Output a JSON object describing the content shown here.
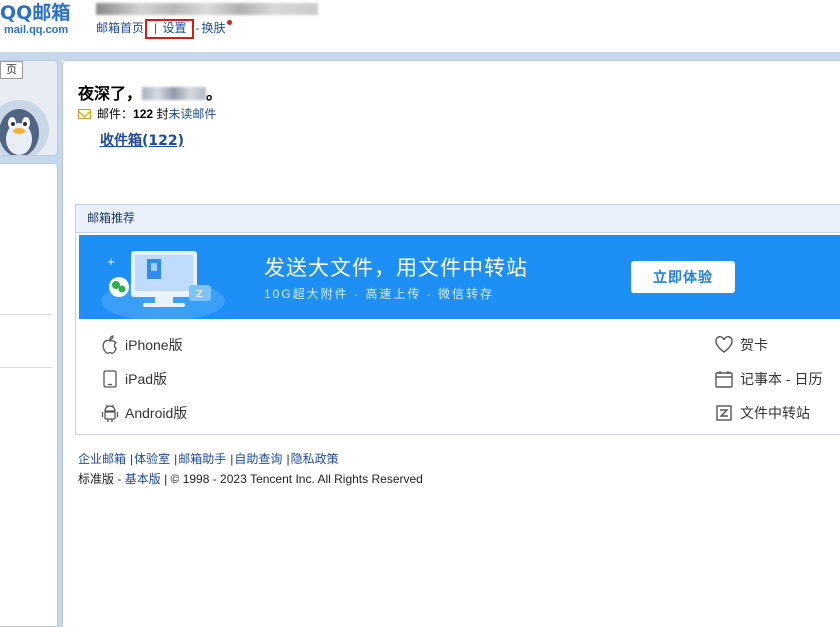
{
  "logo": {
    "main": "QQ邮箱",
    "sub": "mail.qq.com"
  },
  "topnav": {
    "home": "邮箱首页",
    "separator": "|",
    "settings": "设置",
    "dash": "-",
    "skin": "换肤"
  },
  "sidebar": {
    "tooltip": "页"
  },
  "main": {
    "greeting_prefix": "夜深了，",
    "greeting_suffix": "。",
    "mail_label": "邮件：",
    "unread_count": "122",
    "unread_suffix": "封",
    "unread_link": "未读邮件",
    "inbox_link": "收件箱(122)"
  },
  "recommend": {
    "header": "邮箱推荐",
    "banner": {
      "title": "发送大文件，用文件中转站",
      "subtitle": "10G超大附件 · 高速上传 · 微信转存",
      "button": "立即体验"
    },
    "left_items": [
      {
        "label": "iPhone版",
        "icon": "apple-icon"
      },
      {
        "label": "iPad版",
        "icon": "tablet-icon"
      },
      {
        "label": "Android版",
        "icon": "android-icon"
      }
    ],
    "right_items": [
      {
        "label": "贺卡",
        "icon": "heart-icon"
      },
      {
        "label": "记事本 - 日历",
        "icon": "calendar-icon"
      },
      {
        "label": "文件中转站",
        "icon": "file-transfer-icon"
      }
    ]
  },
  "footer": {
    "links": [
      "企业邮箱",
      "体验室",
      "邮箱助手",
      "自助查询",
      "隐私政策"
    ],
    "version_standard": "标准版",
    "version_dash": "-",
    "version_basic": "基本版",
    "copyright": "| © 1998 - 2023 Tencent Inc. All Rights Reserved"
  },
  "colors": {
    "brand": "#2a6fc9",
    "link": "#1d4a9a",
    "banner": "#1e90f5",
    "frame": "#c7d8ec",
    "highlight": "#d61b1b"
  }
}
